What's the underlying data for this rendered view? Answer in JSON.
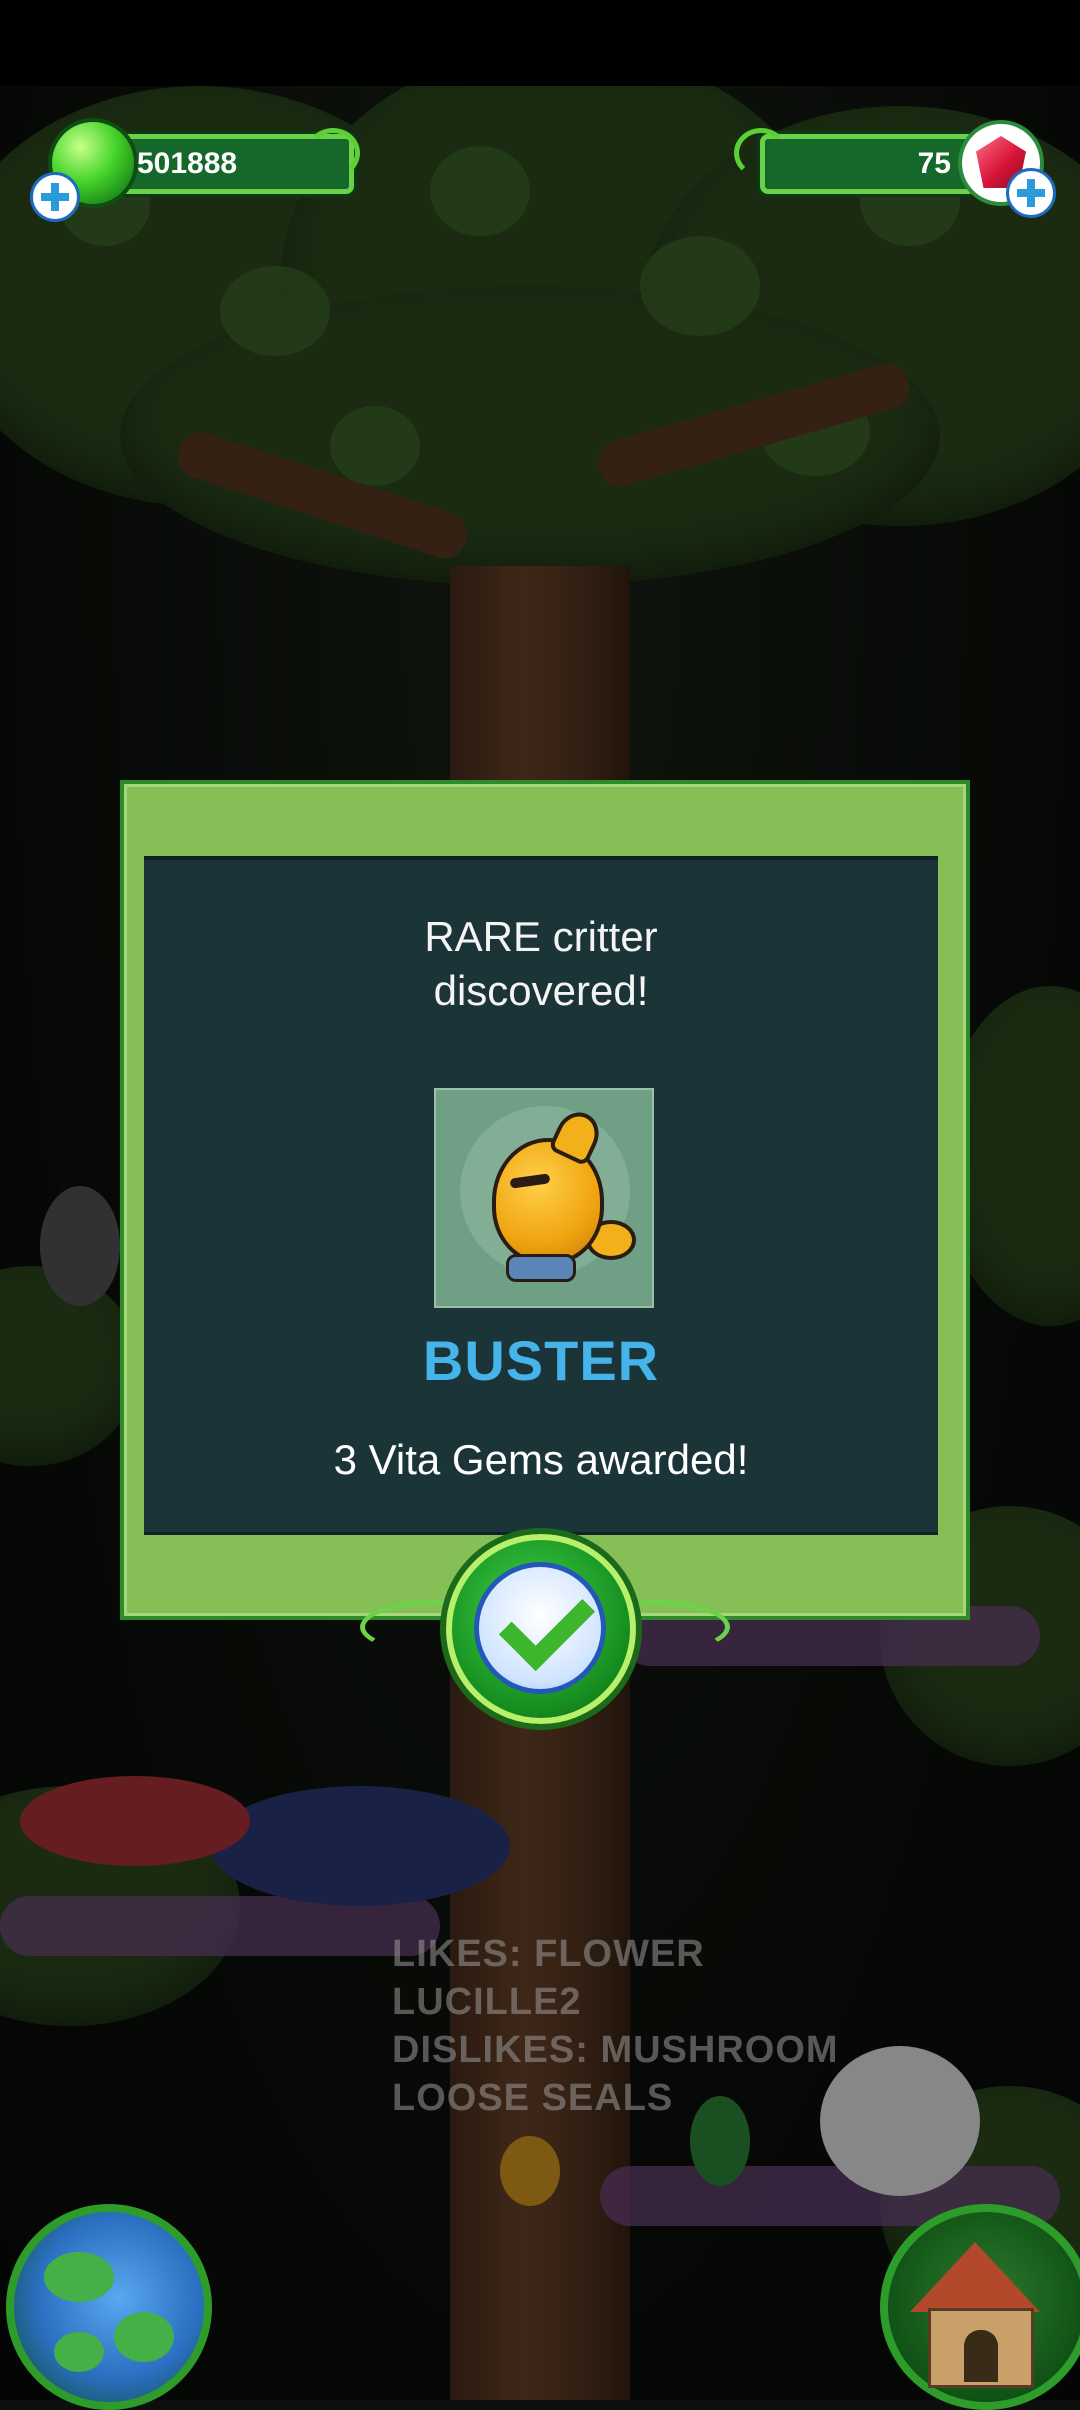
{
  "hud": {
    "fruit_count": "501888",
    "gem_count": "75"
  },
  "dialog": {
    "title_line1": "RARE critter",
    "title_line2": "discovered!",
    "critter_name": "BUSTER",
    "award_text": "3 Vita Gems awarded!"
  },
  "background_info": {
    "line1": "LIKES: FLOWER",
    "line2": "LUCILLE2",
    "line3": "DISLIKES: MUSHROOM",
    "line4": "LOOSE SEALS"
  },
  "colors": {
    "panel_green": "#86bf55",
    "panel_dark": "#1b3438",
    "name_blue": "#45b4ea",
    "hud_green": "#15672a"
  },
  "icons": [
    "fruit-orb-icon",
    "gem-icon",
    "plus-icon",
    "check-icon",
    "globe-icon",
    "house-icon"
  ]
}
